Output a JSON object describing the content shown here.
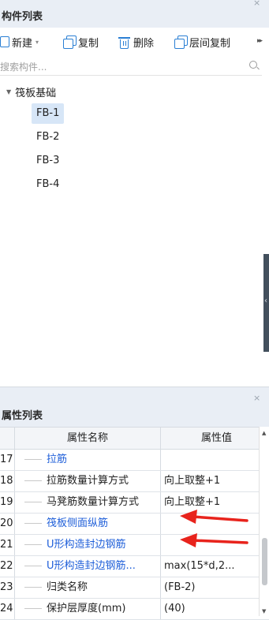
{
  "component_panel": {
    "title": "构件列表",
    "close_symbol": "×",
    "toolbar": {
      "new_label": "新建",
      "copy_label": "复制",
      "delete_label": "删除",
      "floor_copy_label": "层间复制",
      "more_symbol": "▸▸",
      "dropdown_symbol": "▾"
    },
    "search": {
      "placeholder": "搜索构件..."
    },
    "tree": {
      "root_label": "筏板基础",
      "items": [
        {
          "label": "FB-1",
          "selected": true
        },
        {
          "label": "FB-2",
          "selected": false
        },
        {
          "label": "FB-3",
          "selected": false
        },
        {
          "label": "FB-4",
          "selected": false
        }
      ]
    }
  },
  "property_panel": {
    "title": "属性列表",
    "close_symbol": "×",
    "columns": {
      "name": "属性名称",
      "value": "属性值"
    },
    "rows": [
      {
        "num": "17",
        "name": "拉筋",
        "value": "",
        "blue": true
      },
      {
        "num": "18",
        "name": "拉筋数量计算方式",
        "value": "向上取整+1",
        "blue": false
      },
      {
        "num": "19",
        "name": "马凳筋数量计算方式",
        "value": "向上取整+1",
        "blue": false
      },
      {
        "num": "20",
        "name": "筏板侧面纵筋",
        "value": "",
        "blue": true
      },
      {
        "num": "21",
        "name": "U形构造封边钢筋",
        "value": "",
        "blue": true
      },
      {
        "num": "22",
        "name": "U形构造封边钢筋...",
        "value": "max(15*d,2...",
        "blue": true
      },
      {
        "num": "23",
        "name": "归类名称",
        "value": "(FB-2)",
        "blue": false
      },
      {
        "num": "24",
        "name": "保护层厚度(mm)",
        "value": "(40)",
        "blue": false
      }
    ]
  },
  "colors": {
    "accent_blue": "#1f5fd9",
    "selected_bg": "#d7e6f7",
    "annotation_arrow": "#e8231c"
  }
}
